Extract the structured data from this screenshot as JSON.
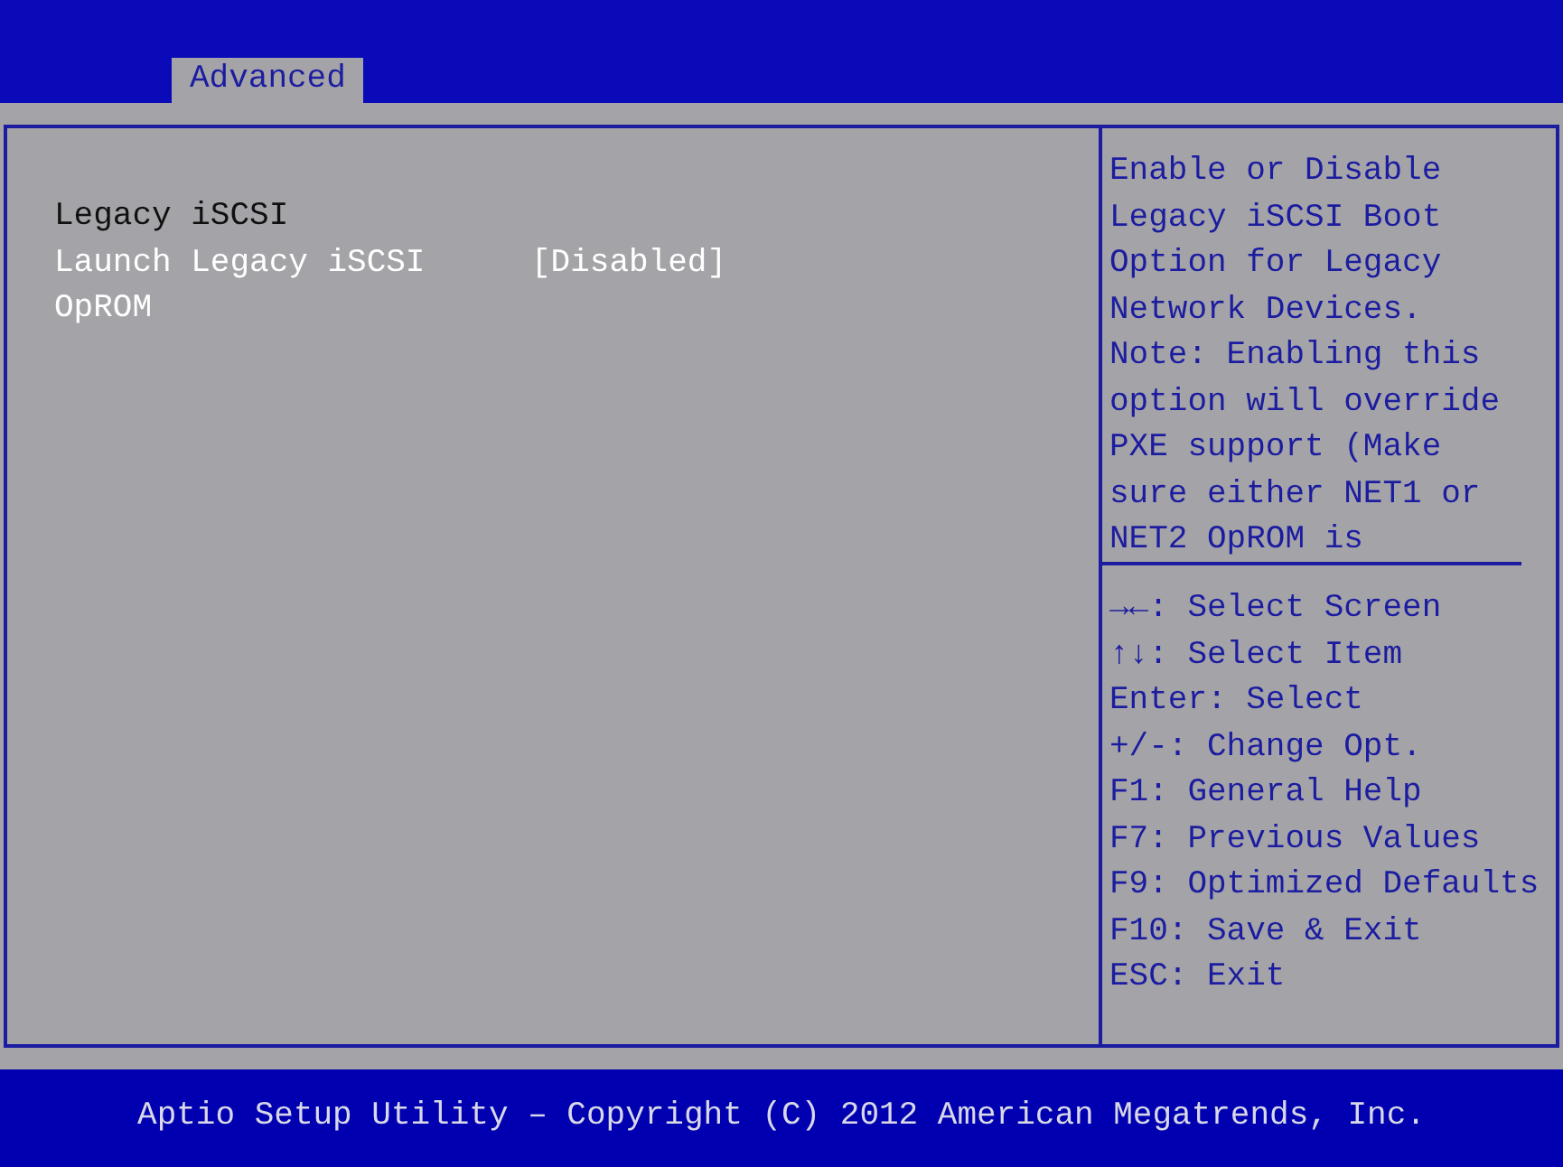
{
  "tabs": [
    {
      "label": "Advanced",
      "selected": true
    }
  ],
  "section_title": "Legacy iSCSI",
  "settings": [
    {
      "label": "Launch Legacy iSCSI OpROM",
      "value": "[Disabled]",
      "selected": true
    }
  ],
  "help_text": "Enable or Disable Legacy iSCSI Boot Option for Legacy Network Devices. Note: Enabling this option will override PXE support (Make sure either NET1 or NET2 OpROM is",
  "key_help": [
    "→←: Select Screen",
    "↑↓: Select Item",
    "Enter: Select",
    "+/-: Change Opt.",
    "F1: General Help",
    "F7: Previous Values",
    "F9: Optimized Defaults",
    "F10: Save & Exit",
    "ESC: Exit"
  ],
  "footer": "Aptio Setup Utility – Copyright (C) 2012 American Megatrends, Inc."
}
